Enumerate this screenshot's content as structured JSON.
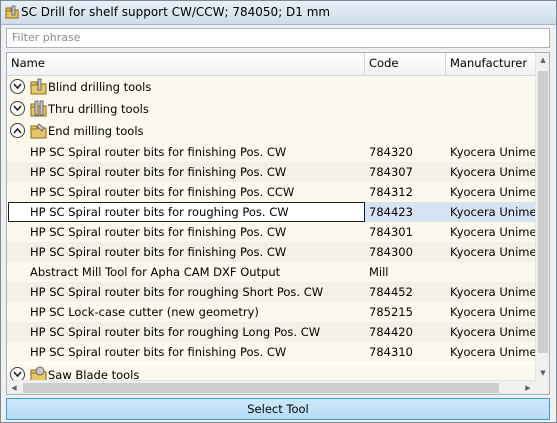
{
  "window": {
    "title": "SC Drill for shelf support CW/CCW; 784050; D1 mm"
  },
  "filter": {
    "placeholder": "Filter phrase"
  },
  "columns": {
    "name": "Name",
    "code": "Code",
    "manufacturer": "Manufacturer"
  },
  "groups": [
    {
      "label": "Blind drilling tools",
      "icon": "drill-folder-icon",
      "state": "collapsed"
    },
    {
      "label": "Thru drilling tools",
      "icon": "drill-folder-icon",
      "state": "collapsed"
    },
    {
      "label": "End milling tools",
      "icon": "end-mill-folder-icon",
      "state": "expanded"
    },
    {
      "label": "Saw Blade tools",
      "icon": "saw-blade-folder-icon",
      "state": "collapsed"
    }
  ],
  "rows": [
    {
      "name": "HP SC Spiral router bits for finishing Pos. CW",
      "code": "784320",
      "manufacturer": "Kyocera Unimerco"
    },
    {
      "name": "HP SC Spiral router bits for finishing Pos. CW",
      "code": "784307",
      "manufacturer": "Kyocera Unimerco"
    },
    {
      "name": "HP SC Spiral router bits for finishing Pos. CCW",
      "code": "784312",
      "manufacturer": "Kyocera Unimerco"
    },
    {
      "name": "HP SC Spiral router bits for roughing Pos. CW",
      "code": "784423",
      "manufacturer": "Kyocera Unimerco"
    },
    {
      "name": "HP SC Spiral router bits for finishing Pos. CW",
      "code": "784301",
      "manufacturer": "Kyocera Unimerco"
    },
    {
      "name": "HP SC Spiral router bits for finishing Pos. CW",
      "code": "784300",
      "manufacturer": "Kyocera Unimerco"
    },
    {
      "name": "Abstract Mill Tool for Apha CAM DXF Output",
      "code": "Mill",
      "manufacturer": ""
    },
    {
      "name": "HP SC Spiral router bits for roughing Short Pos. CW",
      "code": "784452",
      "manufacturer": "Kyocera Unimerco"
    },
    {
      "name": "HP SC Lock-case cutter (new geometry)",
      "code": "785215",
      "manufacturer": "Kyocera Unimerco"
    },
    {
      "name": "HP SC Spiral router bits for roughing Long Pos. CW",
      "code": "784420",
      "manufacturer": "Kyocera Unimerco"
    },
    {
      "name": "HP SC Spiral router bits for finishing Pos. CW",
      "code": "784310",
      "manufacturer": "Kyocera Unimerco"
    }
  ],
  "selected_row_code": "784423",
  "select_button": {
    "label": "Select Tool"
  },
  "colors": {
    "accent": "#3c9be0",
    "selection": "#d5e3f2",
    "row_background": "#fbf9ee"
  }
}
